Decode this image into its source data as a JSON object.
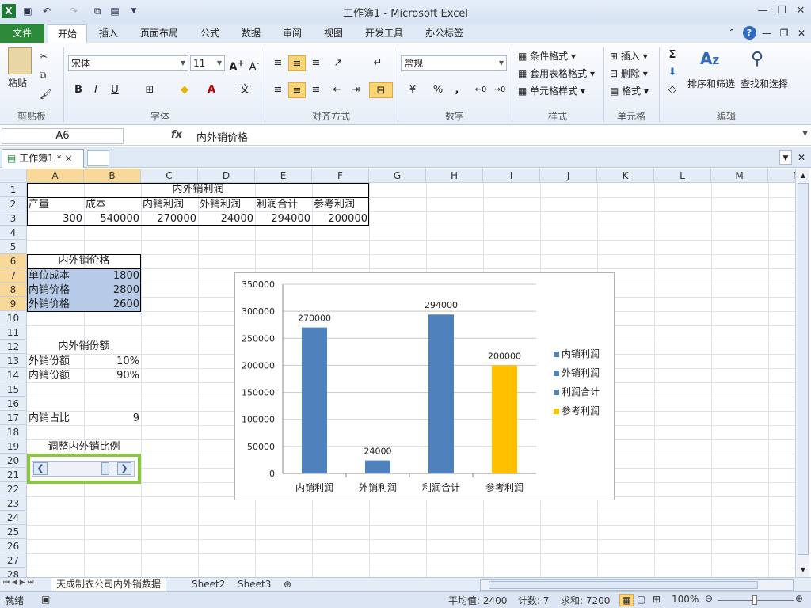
{
  "app": {
    "title": "工作簿1 - Microsoft Excel"
  },
  "ribbon": {
    "tabs": [
      "文件",
      "开始",
      "插入",
      "页面布局",
      "公式",
      "数据",
      "审阅",
      "视图",
      "开发工具",
      "办公标签"
    ],
    "clipboard": {
      "label": "剪贴板",
      "paste": "粘贴"
    },
    "font": {
      "label": "字体",
      "name": "宋体",
      "size": "11",
      "bold": "B",
      "italic": "I",
      "underline": "U"
    },
    "alignment": {
      "label": "对齐方式"
    },
    "number": {
      "label": "数字",
      "format": "常规",
      "percent": "%",
      "comma": ","
    },
    "styles": {
      "label": "样式",
      "conditional": "条件格式",
      "table": "套用表格格式",
      "cell": "单元格样式"
    },
    "cells": {
      "label": "单元格",
      "insert": "插入",
      "delete": "删除",
      "format": "格式"
    },
    "editing": {
      "label": "编辑",
      "sigma": "Σ",
      "sort": "排序和筛选",
      "find": "查找和选择"
    }
  },
  "formula_bar": {
    "name_box": "A6",
    "fx": "fx",
    "content": "内外销价格"
  },
  "workbook_tab": {
    "label": "工作簿1 *",
    "close": "×"
  },
  "columns": [
    "A",
    "B",
    "C",
    "D",
    "E",
    "F",
    "G",
    "H",
    "I",
    "J",
    "K",
    "L",
    "M",
    "N"
  ],
  "rows": [
    "1",
    "2",
    "3",
    "4",
    "5",
    "6",
    "7",
    "8",
    "9",
    "10",
    "11",
    "12",
    "13",
    "14",
    "15",
    "16",
    "17",
    "18",
    "19",
    "20",
    "21",
    "22",
    "23",
    "24",
    "25",
    "26",
    "27",
    "28"
  ],
  "cells": {
    "c1": "内外销利润",
    "a2": "产量",
    "b2": "成本",
    "c2": "内销利润",
    "d2": "外销利润",
    "e2": "利润合计",
    "f2": "参考利润",
    "a3": "300",
    "b3": "540000",
    "c3": "270000",
    "d3": "24000",
    "e3": "294000",
    "f3": "200000",
    "a6": "内外销价格",
    "a7": "单位成本",
    "b7": "1800",
    "a8": "内销价格",
    "b8": "2800",
    "a9": "外销价格",
    "b9": "2600",
    "a12": "内外销份额",
    "a13": "外销份额",
    "b13": "10%",
    "a14": "内销份额",
    "b14": "90%",
    "a17": "内销占比",
    "b17": "9",
    "a19": "调整内外销比例"
  },
  "colors": {
    "series_blue": "#4f81bd",
    "series_orange": "#ffc000",
    "accent_green": "#8cc63e",
    "selection": "#b7cbe8"
  },
  "chart_data": {
    "type": "bar",
    "categories": [
      "内销利润",
      "外销利润",
      "利润合计",
      "参考利润"
    ],
    "values": [
      270000,
      24000,
      294000,
      200000
    ],
    "bar_colors": [
      "#4f81bd",
      "#4f81bd",
      "#4f81bd",
      "#ffc000"
    ],
    "data_labels": [
      "270000",
      "24000",
      "294000",
      "200000"
    ],
    "ylim": [
      0,
      350000
    ],
    "yticks": [
      0,
      50000,
      100000,
      150000,
      200000,
      250000,
      300000,
      350000
    ],
    "legend": [
      {
        "name": "内销利润",
        "color": "#4f81bd"
      },
      {
        "name": "外销利润",
        "color": "#4f81bd"
      },
      {
        "name": "利润合计",
        "color": "#4f81bd"
      },
      {
        "name": "参考利润",
        "color": "#ffc000"
      }
    ],
    "legend_position": "right",
    "grid": true
  },
  "sheet_tabs": [
    "天成制衣公司内外销数据",
    "Sheet2",
    "Sheet3"
  ],
  "status": {
    "ready": "就绪",
    "average": "平均值: 2400",
    "count": "计数: 7",
    "sum": "求和: 7200",
    "zoom": "100%"
  }
}
